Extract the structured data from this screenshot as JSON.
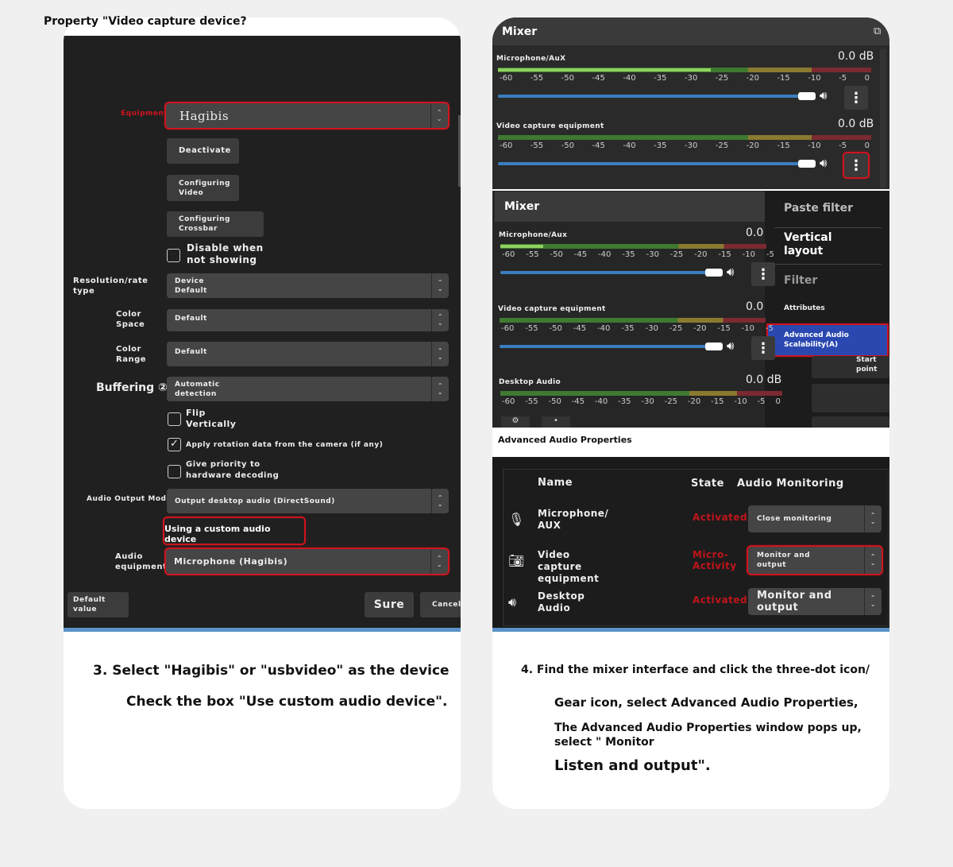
{
  "left": {
    "title": "Property \"Video capture device?",
    "device_label": "Equipment",
    "device_value": "Hagibis",
    "btn_deactivate": "Deactivate",
    "btn_config_video": "Configuring Video",
    "btn_config_crossbar": "Configuring Crossbar",
    "chk_disable": "Disable when not showing",
    "res_label": "Resolution/rate type",
    "res_value": "Device Default",
    "cs_label": "Color Space",
    "cs_value": "Default",
    "cr_label": "Color Range",
    "cr_value": "Default",
    "buf_label": "Buffering ②",
    "buf_value": "Automatic detection",
    "chk_flip": "Flip Vertically",
    "chk_rotation": "Apply rotation data from the camera (if any)",
    "rotation_checked": true,
    "chk_hw": "Give priority to hardware decoding",
    "aom_label": "Audio Output Mode",
    "aom_value": "Output desktop audio (DirectSound)",
    "custom_audio": "Using a custom audio device",
    "ae_label": "Audio equipment",
    "ae_value": "Microphone (Hagibis)",
    "btn_default": "Default value",
    "btn_sure": "Sure",
    "btn_cancel": "Cancel",
    "step_line1": "3. Select \"Hagibis\" or \"usbvideo\" as the device",
    "step_line2": "Check the box \"Use custom audio device\"."
  },
  "right": {
    "mixer_title": "Mixer",
    "ticks": [
      "-60",
      "-55",
      "-50",
      "-45",
      "-40",
      "-35",
      "-30",
      "-25",
      "-20",
      "-15",
      "-10",
      "-5",
      "0"
    ],
    "ticks_cut": [
      "-60",
      "-55",
      "-50",
      "-45",
      "-40",
      "-35",
      "-30",
      "-25",
      "-20",
      "-15",
      "-10",
      "-5"
    ],
    "top_rows": [
      {
        "name": "Microphone/AuX",
        "db": "0.0 dB"
      },
      {
        "name": "Video capture equipment",
        "db": "0.0 dB"
      }
    ],
    "mid_rows": [
      {
        "name": "Microphone/Aux",
        "db": "0.0"
      },
      {
        "name": "Video capture equipment",
        "db": "0.0"
      },
      {
        "name": "Desktop Audio",
        "db": "0.0 dB"
      }
    ],
    "menu": {
      "paste": "Paste filter",
      "vertical": "Vertical layout",
      "filter": "Filter",
      "attributes": "Attributes",
      "advanced": "Advanced Audio Scalability(A)",
      "start": "Start point"
    },
    "aap_title": "Advanced Audio Properties",
    "table": {
      "headers": [
        "Name",
        "State",
        "Audio Monitoring"
      ],
      "rows": [
        {
          "icon": "microphone-icon",
          "name": "Microphone/ AUX",
          "state": "Activated",
          "monitoring": "Close monitoring"
        },
        {
          "icon": "camera-icon",
          "name": "Video capture equipment",
          "state": "Micro-Activity",
          "monitoring": "Monitor and output"
        },
        {
          "icon": "speaker-icon",
          "name": "Desktop Audio",
          "state": "Activated",
          "monitoring": "Monitor and output"
        }
      ]
    },
    "step_line1": "4. Find the mixer interface and click the three-dot icon/",
    "step_line2": "Gear icon, select Advanced Audio Properties,",
    "step_line3": "The Advanced Audio Properties window pops up, select \" Monitor",
    "step_line4": "Listen and output\"."
  },
  "colors": {
    "accent_red": "#d0141e",
    "slider_blue": "#3a7ec0",
    "menu_highlight": "#2a48b0"
  }
}
